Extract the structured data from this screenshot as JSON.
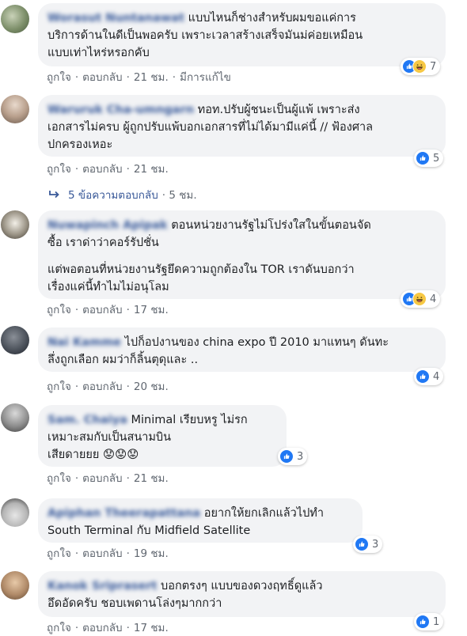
{
  "actions": {
    "like": "ถูกใจ",
    "reply": "ตอบกลับ",
    "separator": "·"
  },
  "accent_color": "#365899",
  "like_color": "#2078f4",
  "comments": [
    {
      "name": "Worasut Nuntanawat",
      "text": "แบบไหนก็ช่างสำหรับผมขอแค่การบริการด้านในดีเป็นพอครับ เพราะเวลาสร้างเสร็จมันมค่อยเหมือนแบบเท่าไหร่หรอกคับ",
      "text_lines": [
        "แบบไหนก็ช่างสำหรับผมขอแค่การ",
        "บริการด้านในดีเป็นพอครับ เพราะเวลาสร้างเสร็จมันม่ค่อยเหมือน",
        "แบบเท่าไหร่หรอกคับ"
      ],
      "time": "21 ชม.",
      "edited": "มีการแก้ไข",
      "reactions": [
        "like",
        "haha"
      ],
      "reaction_count": "7"
    },
    {
      "name": "Waruruk Cha-umngarn",
      "text_lines": [
        "ทอท.ปรับผู้ชนะเป็นผู้แพ้ เพราะส่ง",
        "เอกสารไม่ครบ ผู้ถูกปรับแพ้บอกเอกสารที่ไม่ได้มามีแค่นี้ // ฟ้องศาล",
        "ปกครองเหอะ"
      ],
      "time": "21 ชม.",
      "reactions": [
        "like"
      ],
      "reaction_count": "5",
      "replies_label": "5 ข้อความตอบกลับ",
      "replies_time": "5 ชม."
    },
    {
      "name": "Nuwapinch Apipak",
      "text_lines": [
        "ตอนหน่วยงานรัฐไม่โปร่งใสในขั้นตอนจัด",
        "ซื้อ เราด่าว่าคอร์รัปชั่น"
      ],
      "text_lines_2": [
        "แต่พอตอนที่หน่วยงานรัฐยึดความถูกต้องใน TOR เราดันบอกว่า",
        "เรื่องแค่นี้ทำไมไม่อนุโลม"
      ],
      "time": "17 ชม.",
      "reactions": [
        "like",
        "haha"
      ],
      "reaction_count": "4"
    },
    {
      "name": "Nai Kamme",
      "text_lines": [
        "ไปก็อปงานของ china expo ปี 2010 มาแทนๆ ดันทะ",
        "ลึ่งถูกเลือก ผมว่าก็ลิ้นตุดุและ .."
      ],
      "time": "20 ชม.",
      "reactions": [
        "like"
      ],
      "reaction_count": "4"
    },
    {
      "name": "Sam. Chaiya",
      "text_lines": [
        "Minimal เรียบหรู ไม่รก",
        "เหมาะสมกับเป็นสนามบิน",
        "เสียดายยย 😟😟😟"
      ],
      "time": "21 ชม.",
      "reactions": [
        "like"
      ],
      "reaction_count": "3"
    },
    {
      "name": "Apiphan Theerapattana",
      "text_lines": [
        "อยากให้ยกเลิกแล้วไปทำ",
        "South Terminal กับ Midfield Satellite"
      ],
      "time": "19 ชม.",
      "reactions": [
        "like"
      ],
      "reaction_count": "3"
    },
    {
      "name": "Kanok Sriprasert",
      "text_lines": [
        "บอกตรงๆ แบบของดวงฤทธิ์ดูแล้ว",
        "อึดอัดครับ ชอบเพดานโล่งๆมากกว่า"
      ],
      "time": "17 ชม.",
      "reactions": [
        "like"
      ],
      "reaction_count": "1"
    }
  ]
}
